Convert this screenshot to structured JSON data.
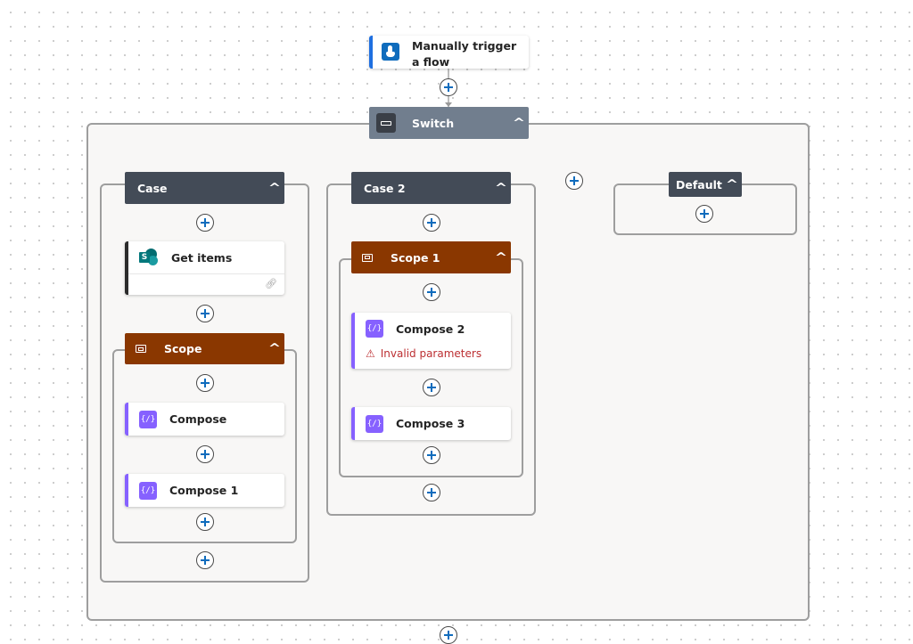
{
  "trigger": {
    "label": "Manually trigger a flow",
    "icon": "touch-hand-icon",
    "accent": "#1e6fe0"
  },
  "switch": {
    "label": "Switch",
    "icon": "switch-icon",
    "color": "#717e8e"
  },
  "cases": [
    {
      "label": "Case",
      "get_items": {
        "label": "Get items",
        "icon": "sharepoint-icon"
      },
      "scope": {
        "label": "Scope",
        "items": [
          {
            "label": "Compose"
          },
          {
            "label": "Compose 1"
          }
        ]
      }
    },
    {
      "label": "Case 2",
      "scope": {
        "label": "Scope 1",
        "items": [
          {
            "label": "Compose 2",
            "error": "Invalid parameters"
          },
          {
            "label": "Compose 3"
          }
        ]
      }
    }
  ],
  "default": {
    "label": "Default"
  },
  "colors": {
    "scope": "#8a3700",
    "case": "#434b57",
    "compose": "#8661ff",
    "error": "#bc2f32",
    "plus": "#0f6cbd"
  }
}
